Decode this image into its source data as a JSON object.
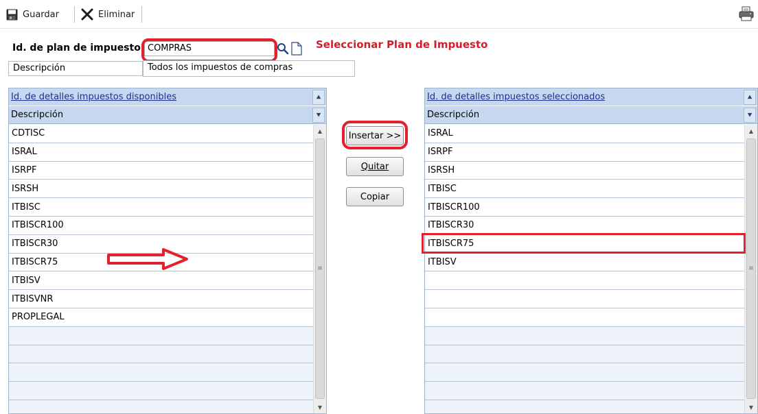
{
  "toolbar": {
    "save_label": "Guardar",
    "delete_label": "Eliminar"
  },
  "header": {
    "plan_id_label": "Id. de plan de impuesto",
    "plan_id_value": "COMPRAS",
    "description_label": "Descripción",
    "description_value": "Todos los impuestos de compras",
    "annotation": "Seleccionar Plan de Impuesto"
  },
  "available": {
    "title": "Id. de detalles impuestos disponibles",
    "column": "Descripción",
    "rows": [
      "CDTISC",
      "ISRAL",
      "ISRPF",
      "ISRSH",
      "ITBISC",
      "ITBISCR100",
      "ITBISCR30",
      "ITBISCR75",
      "ITBISV",
      "ITBISVNR",
      "PROPLEGAL",
      "",
      "",
      "",
      "",
      ""
    ]
  },
  "selected": {
    "title": "Id. de detalles impuestos seleccionados",
    "column": "Descripción",
    "rows": [
      "ISRAL",
      "ISRPF",
      "ISRSH",
      "ITBISC",
      "ITBISCR100",
      "ITBISCR30",
      "ITBISCR75",
      "ITBISV",
      "",
      "",
      "",
      "",
      "",
      "",
      "",
      ""
    ]
  },
  "actions": {
    "insert": "Insertar >>",
    "remove": "Quitar",
    "copy": "Copiar"
  },
  "colors": {
    "annotation_red": "#e2202e",
    "grid_header": "#c6d8ef",
    "link_blue": "#1c2f8a"
  }
}
